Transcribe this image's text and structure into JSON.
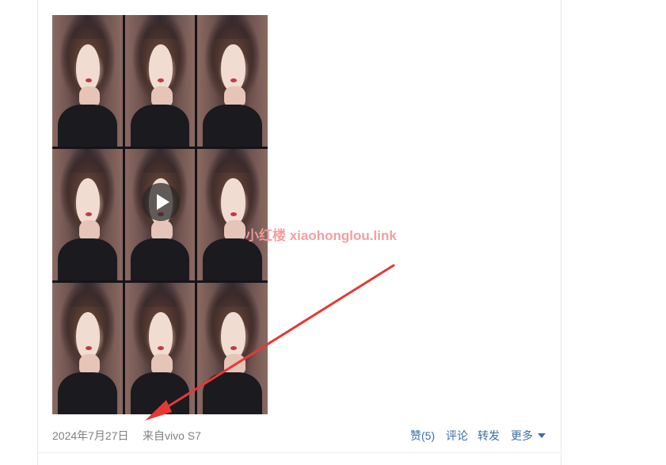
{
  "post": {
    "date": "2024年7月27日",
    "source": "来自vivo S7",
    "media": {
      "type": "video",
      "play_icon": "play-icon"
    }
  },
  "actions": {
    "like_label": "赞(5)",
    "comment_label": "评论",
    "repost_label": "转发",
    "more_label": "更多",
    "more_icon": "caret-down-icon"
  },
  "watermark": {
    "text": "小红楼  xiaohonglou.link"
  },
  "colors": {
    "link": "#3b6ea5",
    "meta_text": "#808080",
    "annotation_arrow": "#e53935",
    "watermark": "#f29a9a"
  }
}
